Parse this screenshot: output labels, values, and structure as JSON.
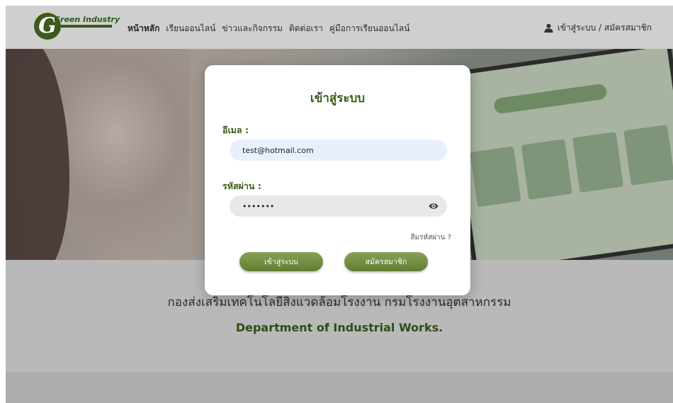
{
  "logo": {
    "name": "Green Industry"
  },
  "nav": {
    "items": [
      "หน้าหลัก",
      "เรียนออนไลน์",
      "ข่าวและกิจกรรม",
      "ติดต่อเรา",
      "คู่มือการเรียนออนไลน์"
    ]
  },
  "auth": {
    "label": "เข้าสู่ระบบ / สมัครสมาชิก",
    "icon": "user-icon"
  },
  "modal": {
    "title": "เข้าสู่ระบบ",
    "email_label": "อีเมล :",
    "email_value": "test@hotmail.com",
    "password_label": "รหัสผ่าน :",
    "password_value": "•••••••",
    "forgot": "ลืมรหัสผ่าน ?",
    "login_button": "เข้าสู่ระบบ",
    "register_button": "สมัครสมาชิก"
  },
  "lower": {
    "th": "กองส่งเสริมเทคโนโลยีสิ่งแวดล้อมโรงงาน กรมโรงงานอุตสาหกรรม",
    "en": "Department of Industrial Works."
  },
  "colors": {
    "accent": "#5f7d31",
    "title": "#3c5b18"
  }
}
